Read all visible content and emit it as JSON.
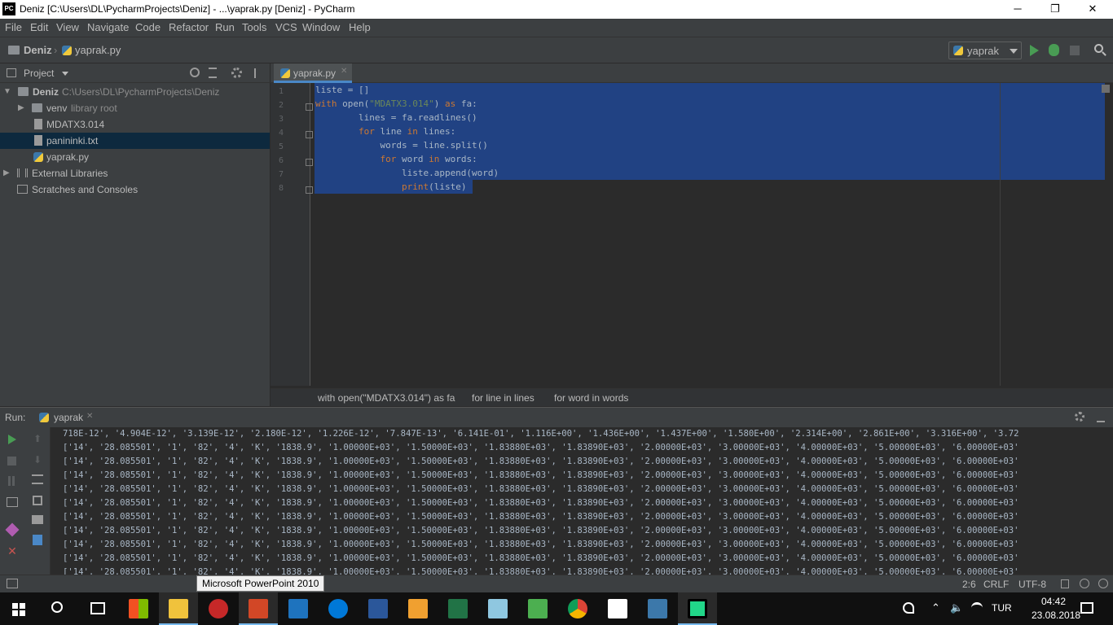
{
  "window": {
    "title": "Deniz [C:\\Users\\DL\\PycharmProjects\\Deniz] - ...\\yaprak.py [Deniz] - PyCharm",
    "app_icon_text": "PC",
    "minimize_glyph": "─",
    "restore_glyph": "❐",
    "close_glyph": "✕"
  },
  "menu": [
    "File",
    "Edit",
    "View",
    "Navigate",
    "Code",
    "Refactor",
    "Run",
    "Tools",
    "VCS",
    "Window",
    "Help"
  ],
  "navbar": {
    "project": "Deniz",
    "file": "yaprak.py",
    "run_config": "yaprak"
  },
  "project_panel": {
    "title": "Project",
    "tree": [
      {
        "label": "Deniz",
        "path": "C:\\Users\\DL\\PycharmProjects\\Deniz"
      },
      {
        "label": "venv",
        "note": "library root"
      },
      {
        "label": "MDATX3.014"
      },
      {
        "label": "panininki.txt"
      },
      {
        "label": "yaprak.py"
      },
      {
        "label": "External Libraries"
      },
      {
        "label": "Scratches and Consoles"
      }
    ]
  },
  "editor": {
    "tab": "yaprak.py",
    "line_numbers": [
      "1",
      "2",
      "3",
      "4",
      "5",
      "6",
      "7",
      "8"
    ],
    "lines": {
      "l1": "liste = []",
      "l2_kw1": "with ",
      "l2_a": "open(",
      "l2_str": "\"MDATX3.014\"",
      "l2_b": ") ",
      "l2_kw2": "as",
      "l2_c": " fa:",
      "l3": "        lines = fa.readlines()",
      "l4_indent": "        ",
      "l4_kw1": "for",
      "l4_a": " line ",
      "l4_kw2": "in",
      "l4_b": " lines:",
      "l5": "            words = line.split()",
      "l6_indent": "            ",
      "l6_kw1": "for",
      "l6_a": " word ",
      "l6_kw2": "in",
      "l6_b": " words:",
      "l7": "                liste.append(word)",
      "l8_indent": "                ",
      "l8_kw": "print",
      "l8_a": "(liste)"
    }
  },
  "breadcrumbs": [
    "with open(\"MDATX3.014\") as fa",
    "for line in lines",
    "for word in words"
  ],
  "run_panel": {
    "label": "Run:",
    "tab": "yaprak",
    "first_line": "718E-12', '4.904E-12', '3.139E-12', '2.180E-12', '1.226E-12', '7.847E-13', '6.141E-01', '1.116E+00', '1.436E+00', '1.437E+00', '1.580E+00', '2.314E+00', '2.861E+00', '3.316E+00', '3.72",
    "repeat_line": "['14', '28.085501', '1', '82', '4', 'K', '1838.9', '1.00000E+03', '1.50000E+03', '1.83880E+03', '1.83890E+03', '2.00000E+03', '3.00000E+03', '4.00000E+03', '5.00000E+03', '6.00000E+03'",
    "repeat_count": 10
  },
  "status": {
    "position": "2:6",
    "line_sep": "CRLF",
    "encoding": "UTF-8"
  },
  "tooltip": "Microsoft PowerPoint 2010",
  "taskbar": {
    "lang": "TUR",
    "time": "04:42",
    "date": "23.08.2018"
  }
}
